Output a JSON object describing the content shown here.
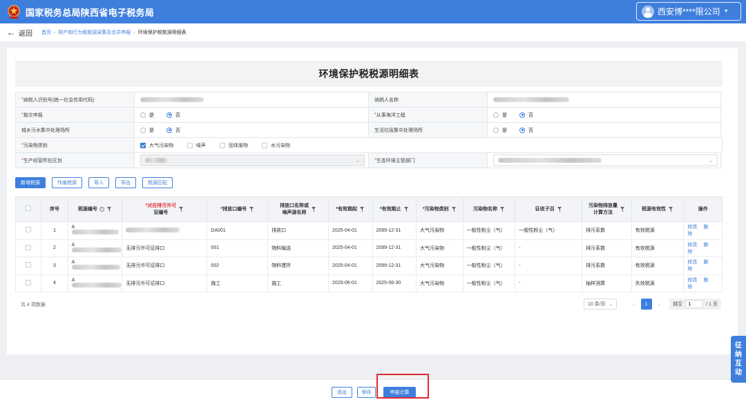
{
  "header": {
    "title": "国家税务总局陕西省电子税务局",
    "company": "西安博****限公司"
  },
  "nav": {
    "back": "返回",
    "crumbs": [
      "首页",
      "财产和行为税税源采集及合并申报",
      "环境保护税税源明细表"
    ]
  },
  "form": {
    "title": "环境保护税税源明细表",
    "labels": {
      "taxpayer_id": "纳税人识别号(统一社会信用代码)",
      "taxpayer_name": "纳税人名称",
      "per_time": "按次申报",
      "ocean": "从事海洋工程",
      "sewage": "城乡污水集中处理场所",
      "garbage": "生活垃圾集中处理场所",
      "pollutant_type": "污染物类别",
      "district": "生产经营所在区划",
      "eco_dept": "生态环境主管部门"
    },
    "yes": "是",
    "no": "否",
    "pollutant_options": [
      {
        "label": "大气污染物",
        "checked": true
      },
      {
        "label": "噪声",
        "checked": false
      },
      {
        "label": "固体废物",
        "checked": false
      },
      {
        "label": "水污染物",
        "checked": false
      }
    ]
  },
  "toolbar": {
    "add": "新增税源",
    "void": "作废税源",
    "import": "导入",
    "export": "导出",
    "match": "税源匹配"
  },
  "table": {
    "headers": {
      "index": "序号",
      "source_no": "税源编号",
      "permit_line1": "*对应排污许可",
      "permit_line2": "证编号",
      "outlet_no": "*排放口编号",
      "outlet_name_line1": "排放口名称或",
      "outlet_name_line2": "噪声源名称",
      "start": "*有效期起",
      "end": "*有效期止",
      "category": "*污染物类别",
      "pollutant": "污染物名称",
      "subitem": "征收子目",
      "method_line1": "污染物排放量",
      "method_line2": "计算方法",
      "validity": "税源有效性",
      "ops": "操作"
    },
    "rows": [
      {
        "index": "1",
        "source_prefix": "A",
        "permit": "",
        "outlet_no": "DA001",
        "outlet_name": "排放口",
        "start": "2025-04-01",
        "end": "2099-12-31",
        "category": "大气污染物",
        "pollutant": "一般性粉尘（气）",
        "subitem": "一般性粉尘（气）",
        "method": "排污系数",
        "validity": "有效税源"
      },
      {
        "index": "2",
        "source_prefix": "A",
        "permit": "无排污许可证排口",
        "outlet_no": "001",
        "outlet_name": "物料输送",
        "start": "2025-04-01",
        "end": "2099-12-31",
        "category": "大气污染物",
        "pollutant": "一般性粉尘（气）",
        "subitem": "-",
        "method": "排污系数",
        "validity": "有效税源"
      },
      {
        "index": "3",
        "source_prefix": "A",
        "permit": "无排污许可证排口",
        "outlet_no": "002",
        "outlet_name": "物料搅拌",
        "start": "2025-04-01",
        "end": "2099-12-31",
        "category": "大气污染物",
        "pollutant": "一般性粉尘（气）",
        "subitem": "-",
        "method": "排污系数",
        "validity": "有效税源"
      },
      {
        "index": "4",
        "source_prefix": "A",
        "permit": "无排污许可证排口",
        "outlet_no": "施工",
        "outlet_name": "施工",
        "start": "2025-06-01",
        "end": "2025-06-30",
        "category": "大气污染物",
        "pollutant": "一般性粉尘（气）",
        "subitem": "-",
        "method": "抽样测算",
        "validity": "失效税源"
      }
    ],
    "op_edit": "修改",
    "op_delete": "删除"
  },
  "pager": {
    "total": "共 4 项数据",
    "page_size": "10 条/页",
    "current": "1",
    "goto_label": "跳至",
    "goto_value": "1",
    "pages": "/ 1 页"
  },
  "footer": {
    "exit": "退出",
    "save": "保存",
    "calc": "申报计算"
  },
  "side": {
    "chars": [
      "征",
      "纳",
      "互",
      "动"
    ]
  },
  "colors": {
    "primary": "#3e7fde",
    "highlight": "#e0282e"
  }
}
